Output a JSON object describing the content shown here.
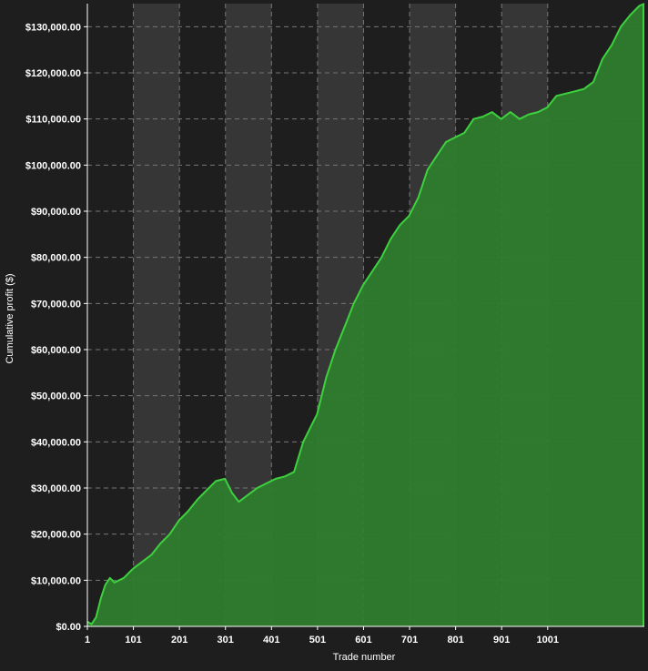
{
  "chart_data": {
    "type": "area",
    "title": "",
    "xlabel": "Trade number",
    "ylabel": "Cumulative profit ($)",
    "xlim": [
      1,
      1211
    ],
    "ylim": [
      0,
      135000
    ],
    "x_ticks": [
      1,
      101,
      201,
      301,
      401,
      501,
      601,
      701,
      801,
      901,
      1001
    ],
    "x_tick_labels": [
      "1",
      "101",
      "201",
      "301",
      "401",
      "501",
      "601",
      "701",
      "801",
      "901",
      "1001"
    ],
    "y_ticks": [
      0,
      10000,
      20000,
      30000,
      40000,
      50000,
      60000,
      70000,
      80000,
      90000,
      100000,
      110000,
      120000,
      130000
    ],
    "y_tick_labels": [
      "$0.00",
      "$10,000.00",
      "$20,000.00",
      "$30,000.00",
      "$40,000.00",
      "$50,000.00",
      "$60,000.00",
      "$70,000.00",
      "$80,000.00",
      "$90,000.00",
      "$100,000.00",
      "$110,000.00",
      "$120,000.00",
      "$130,000.00"
    ],
    "grid": true,
    "series": [
      {
        "x": [
          1,
          10,
          20,
          30,
          40,
          50,
          60,
          80,
          100,
          120,
          140,
          160,
          180,
          200,
          220,
          240,
          260,
          280,
          300,
          315,
          330,
          350,
          370,
          390,
          410,
          430,
          450,
          470,
          490,
          500,
          520,
          540,
          560,
          580,
          600,
          620,
          640,
          660,
          680,
          700,
          720,
          740,
          760,
          780,
          800,
          820,
          840,
          860,
          880,
          900,
          920,
          940,
          960,
          980,
          1000,
          1020,
          1040,
          1060,
          1080,
          1100,
          1120,
          1140,
          1160,
          1180,
          1200,
          1211
        ],
        "y": [
          1000,
          500,
          2000,
          6000,
          9000,
          10500,
          9500,
          10500,
          12500,
          14000,
          15500,
          18000,
          20000,
          23000,
          25000,
          27500,
          29500,
          31500,
          32000,
          29000,
          27000,
          28500,
          30000,
          31000,
          32000,
          32500,
          33500,
          40000,
          44000,
          46000,
          54000,
          60000,
          65000,
          70000,
          74000,
          77000,
          80000,
          84000,
          87000,
          89000,
          93000,
          99000,
          102000,
          105000,
          106000,
          107000,
          110000,
          110500,
          111500,
          110000,
          111500,
          110000,
          111000,
          111500,
          112500,
          115000,
          115500,
          116000,
          116500,
          118000,
          123000,
          126000,
          130000,
          132500,
          134500,
          135000
        ]
      }
    ],
    "colors": {
      "background": "#1e1e1e",
      "band": "#363636",
      "line": "#3ed13e",
      "fill": "#2e7d2e",
      "axis": "#ffffff",
      "grid": "#777777"
    }
  }
}
